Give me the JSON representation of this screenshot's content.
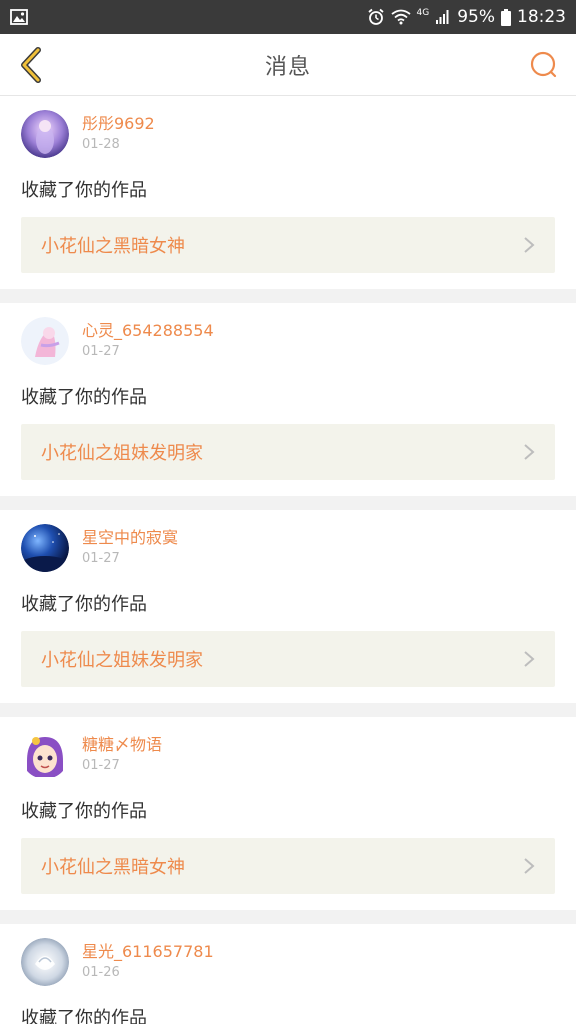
{
  "status_bar": {
    "signal_type": "4G",
    "battery": "95%",
    "time": "18:23"
  },
  "header": {
    "title": "消息"
  },
  "colors": {
    "accent": "#ee8a4c",
    "back_icon": "#e0a630",
    "date": "#b8b8b8",
    "work_bg": "#f3f3eb"
  },
  "messages": [
    {
      "username": "彤彤9692",
      "date": "01-28",
      "action": "收藏了你的作品",
      "work": "小花仙之黑暗女神"
    },
    {
      "username": "心灵_654288554",
      "date": "01-27",
      "action": "收藏了你的作品",
      "work": "小花仙之姐妹发明家"
    },
    {
      "username": "星空中的寂寞",
      "date": "01-27",
      "action": "收藏了你的作品",
      "work": "小花仙之姐妹发明家"
    },
    {
      "username": "糖糖〆物语",
      "date": "01-27",
      "action": "收藏了你的作品",
      "work": "小花仙之黑暗女神"
    },
    {
      "username": "星光_611657781",
      "date": "01-26",
      "action": "收藏了你的作品"
    }
  ]
}
